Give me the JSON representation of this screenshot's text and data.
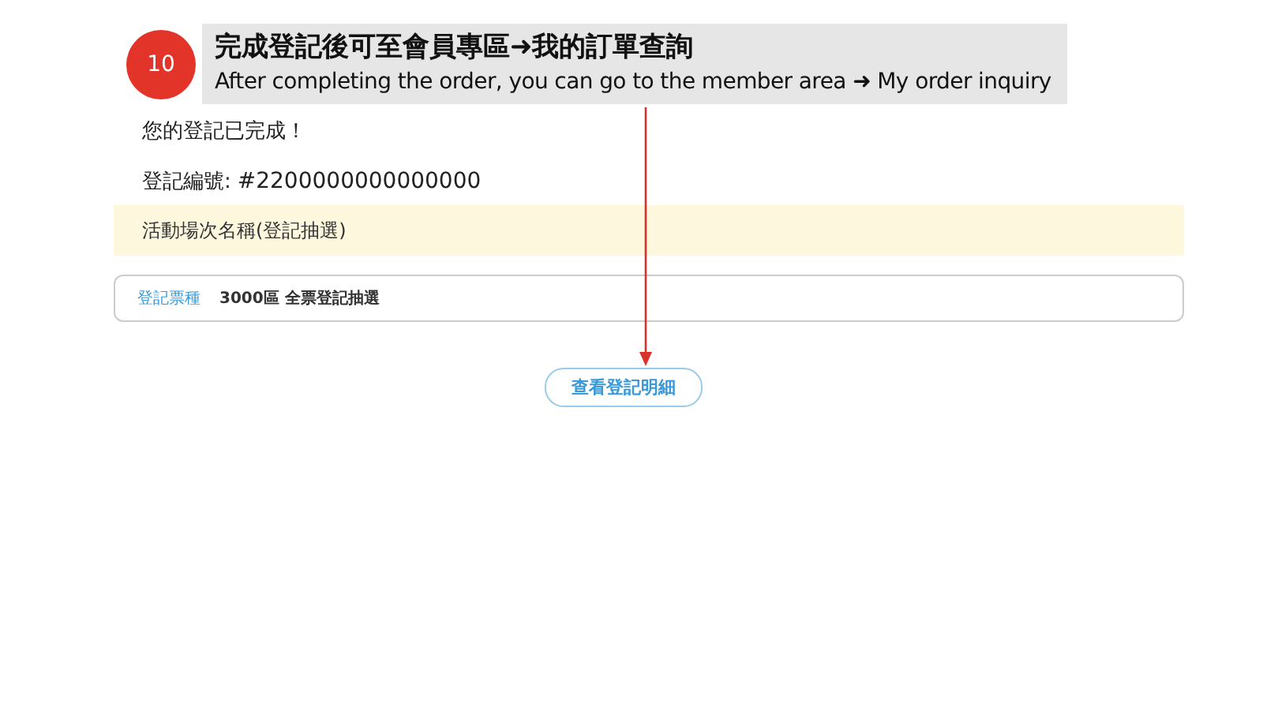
{
  "callout": {
    "step": "10",
    "title": "完成登記後可至會員專區➜我的訂單查詢",
    "subtitle": "After completing the order, you can go to the member area ➜ My order inquiry"
  },
  "page": {
    "message": "您的登記已完成！",
    "registration_label": "登記編號:",
    "registration_number": "#2200000000000000",
    "event_name": "活動場次名稱(登記抽選)",
    "ticket": {
      "label": "登記票種",
      "value": "3000區 全票登記抽選"
    },
    "button": "查看登記明細"
  }
}
